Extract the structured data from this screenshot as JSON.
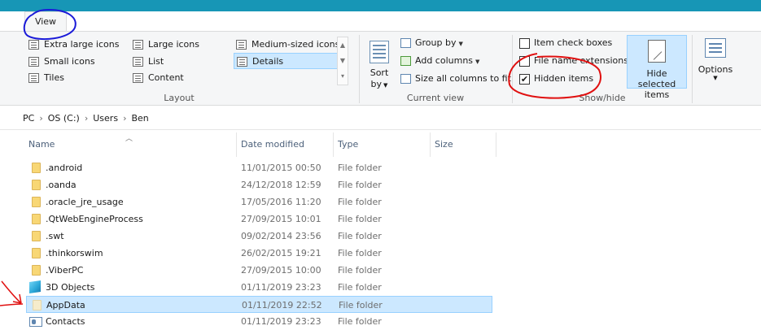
{
  "tabs": {
    "view_label": "View"
  },
  "ribbon": {
    "layout": {
      "group_label": "Layout",
      "items": [
        {
          "label": "Extra large icons",
          "icon": "extra-large-icons-icon"
        },
        {
          "label": "Small icons",
          "icon": "small-icons-icon"
        },
        {
          "label": "Tiles",
          "icon": "tiles-icon"
        },
        {
          "label": "Large icons",
          "icon": "large-icons-icon"
        },
        {
          "label": "List",
          "icon": "list-icon"
        },
        {
          "label": "Content",
          "icon": "content-icon"
        },
        {
          "label": "Medium-sized icons",
          "icon": "medium-icons-icon"
        },
        {
          "label": "Details",
          "icon": "details-icon",
          "selected": true
        }
      ]
    },
    "current_view": {
      "group_label": "Current view",
      "sort_by_label_1": "Sort",
      "sort_by_label_2": "by",
      "group_by_label": "Group by",
      "add_columns_label": "Add columns",
      "size_all_columns_label": "Size all columns to fit"
    },
    "show_hide": {
      "group_label": "Show/hide",
      "item_check_boxes_label": "Item check boxes",
      "item_check_boxes_checked": false,
      "file_name_extensions_label": "File name extensions",
      "file_name_extensions_checked": false,
      "hidden_items_label": "Hidden items",
      "hidden_items_checked": true,
      "checkmark": "✔",
      "hide_selected_label_1": "Hide selected",
      "hide_selected_label_2": "items"
    },
    "options_label": "Options"
  },
  "breadcrumb": [
    "PC",
    "OS (C:)",
    "Users",
    "Ben"
  ],
  "breadcrumb_separator": "›",
  "columns": {
    "name": "Name",
    "date_modified": "Date modified",
    "type": "Type",
    "size": "Size"
  },
  "files": [
    {
      "name": ".android",
      "date": "11/01/2015 00:50",
      "type": "File folder",
      "icon": "folder-icon"
    },
    {
      "name": ".oanda",
      "date": "24/12/2018 12:59",
      "type": "File folder",
      "icon": "folder-icon"
    },
    {
      "name": ".oracle_jre_usage",
      "date": "17/05/2016 11:20",
      "type": "File folder",
      "icon": "folder-icon"
    },
    {
      "name": ".QtWebEngineProcess",
      "date": "27/09/2015 10:01",
      "type": "File folder",
      "icon": "folder-icon"
    },
    {
      "name": ".swt",
      "date": "09/02/2014 23:56",
      "type": "File folder",
      "icon": "folder-icon"
    },
    {
      "name": ".thinkorswim",
      "date": "26/02/2015 19:21",
      "type": "File folder",
      "icon": "folder-icon"
    },
    {
      "name": ".ViberPC",
      "date": "27/09/2015 10:00",
      "type": "File folder",
      "icon": "folder-icon"
    },
    {
      "name": "3D Objects",
      "date": "01/11/2019 23:23",
      "type": "File folder",
      "icon": "3d-objects-icon"
    },
    {
      "name": "AppData",
      "date": "01/11/2019 22:52",
      "type": "File folder",
      "icon": "hidden-folder-icon",
      "selected": true
    },
    {
      "name": "Contacts",
      "date": "01/11/2019 23:23",
      "type": "File folder",
      "icon": "contacts-icon"
    }
  ],
  "colors": {
    "title_bar": "#1796b6",
    "selection_fill": "#cce8ff",
    "selection_border": "#99d1ff",
    "annotation_red": "#e01010",
    "annotation_blue": "#1a1ad8"
  }
}
